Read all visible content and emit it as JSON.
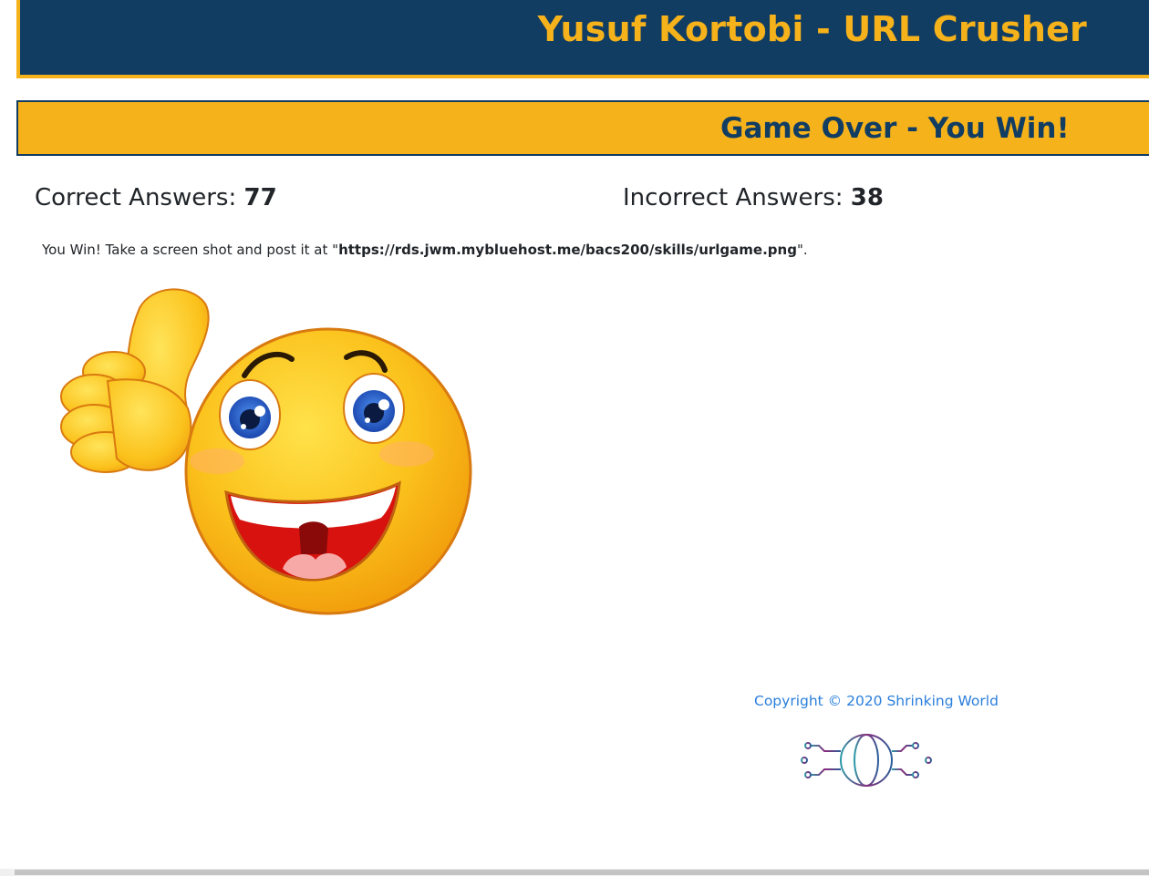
{
  "header": {
    "title": "Yusuf Kortobi - URL Crusher"
  },
  "banner": {
    "title": "Game Over - You Win!"
  },
  "scores": {
    "correct_label": "Correct Answers: ",
    "correct_value": "77",
    "incorrect_label": "Incorrect Answers: ",
    "incorrect_value": "38"
  },
  "message": {
    "prefix": "You Win! Take a screen shot and post it at \"",
    "url": "https://rds.jwm.mybluehost.me/bacs200/skills/urlgame.png",
    "suffix": "\"."
  },
  "images": {
    "emoji": "thumbs-up-smiley-emoji",
    "logo": "circuit-globe-logo"
  },
  "footer": {
    "copyright": "Copyright © 2020 Shrinking World"
  },
  "colors": {
    "navy": "#123d63",
    "gold": "#f6b21b",
    "link_blue": "#2a7fdc"
  }
}
